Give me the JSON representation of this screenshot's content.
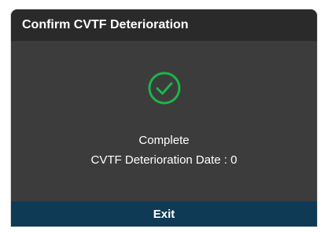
{
  "dialog": {
    "title": "Confirm CVTF Deterioration",
    "status_icon": "check-circle-icon",
    "status_icon_color": "#1db44a",
    "message_line1": "Complete",
    "message_line2": "CVTF Deterioration Date : 0",
    "exit_label": "Exit"
  },
  "colors": {
    "header_bg": "#2a2a2a",
    "body_bg": "#3c3c3c",
    "footer_bg": "#0f3a56",
    "text": "#ffffff"
  }
}
